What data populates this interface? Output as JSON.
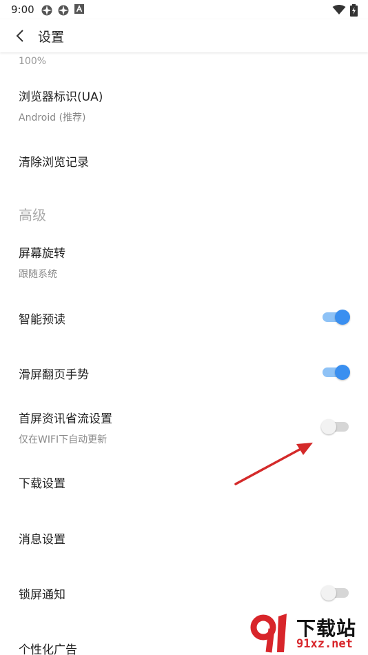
{
  "status_bar": {
    "time": "9:00",
    "left_icons": [
      "notification-icon",
      "notification-icon",
      "a-badge-icon"
    ],
    "right_icons": [
      "wifi-icon",
      "battery-icon"
    ]
  },
  "app_bar": {
    "back_icon": "chevron-left-icon",
    "title": "设置"
  },
  "settings": {
    "text_size_value": "100%",
    "ua": {
      "title": "浏览器标识(UA)",
      "value": "Android (推荐)"
    },
    "clear_history": {
      "title": "清除浏览记录"
    },
    "section_advanced": "高级",
    "rotation": {
      "title": "屏幕旋转",
      "value": "跟随系统"
    },
    "smart_preread": {
      "title": "智能预读",
      "enabled": true
    },
    "swipe_page": {
      "title": "滑屏翻页手势",
      "enabled": true
    },
    "home_data_saving": {
      "title": "首屏资讯省流设置",
      "subtitle": "仅在WIFI下自动更新",
      "enabled": false
    },
    "download": {
      "title": "下载设置"
    },
    "message": {
      "title": "消息设置"
    },
    "lockscreen_notify": {
      "title": "锁屏通知",
      "enabled": false
    },
    "personalized_ads": {
      "title": "个性化广告"
    }
  },
  "watermark": {
    "logo_icon": "91-logo-icon",
    "line1": "下载站",
    "line2": "91xz.net"
  },
  "colors": {
    "accent": "#3a8ff0",
    "accent_track": "#8ec2f6",
    "off_track": "#d6d6d6",
    "annotation_arrow": "#d42a2a"
  }
}
